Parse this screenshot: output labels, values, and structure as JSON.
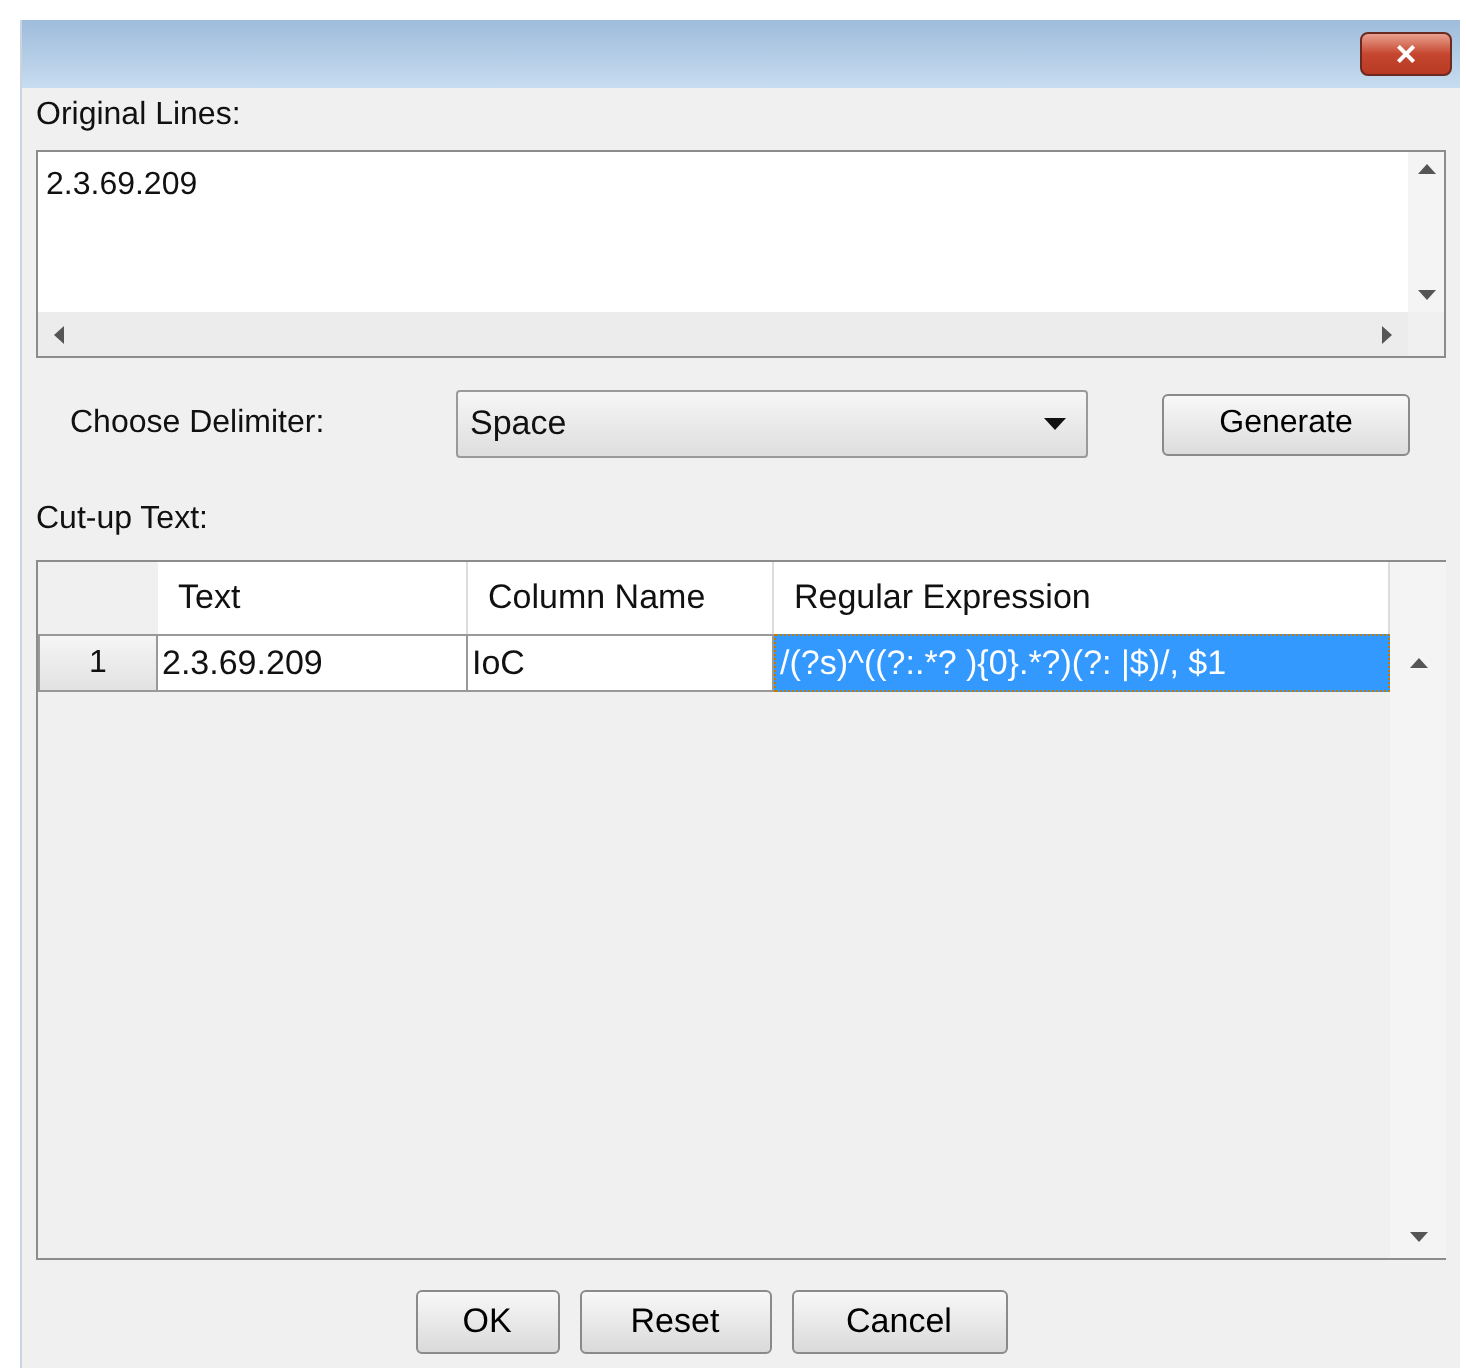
{
  "window": {
    "close_button": "×"
  },
  "original_lines": {
    "label": "Original Lines:",
    "value": "2.3.69.209"
  },
  "delimiter": {
    "label": "Choose Delimiter:",
    "value": "Space"
  },
  "generate_button": "Generate",
  "cut_up": {
    "label": "Cut-up Text:",
    "columns": [
      "Text",
      "Column Name",
      "Regular Expression"
    ],
    "rows": [
      {
        "number": "1",
        "cells": [
          {
            "text": "2.3.69.209",
            "selected": false
          },
          {
            "text": "IoC",
            "selected": false
          },
          {
            "text": "/(?s)^((?:.*? ){0}.*?)(?: |$)/, $1",
            "selected": true
          }
        ]
      }
    ]
  },
  "buttons": [
    "OK",
    "Reset",
    "Cancel"
  ]
}
